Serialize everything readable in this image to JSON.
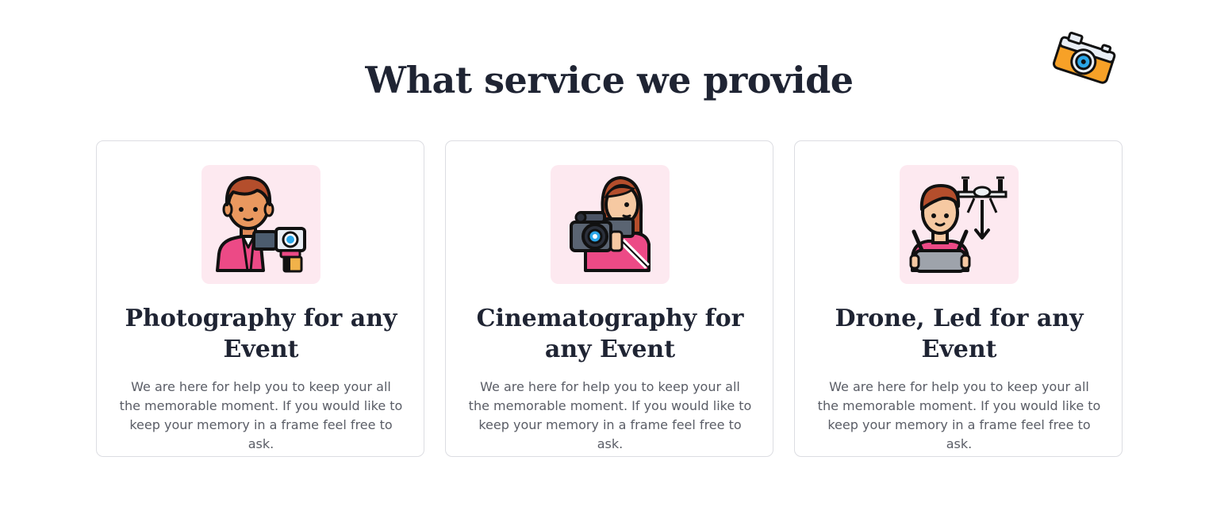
{
  "section": {
    "title": "What service we provide"
  },
  "decor": {
    "camera_icon": "camera-icon"
  },
  "services": [
    {
      "title": "Photography for any Event",
      "description": "We are here for help you to keep your all the memorable moment. If you would like to keep your memory in a frame feel free to ask.",
      "icon": "photographer-icon"
    },
    {
      "title": "Cinematography for any Event",
      "description": "We are here for help you to keep your all the memorable moment. If you would like to keep your memory in a frame feel free to ask.",
      "icon": "videographer-icon"
    },
    {
      "title": "Drone, Led for any Event",
      "description": "We are here for help you to keep your all the memorable moment. If you would like to keep your memory in a frame feel free to ask.",
      "icon": "drone-pilot-icon"
    }
  ],
  "colors": {
    "heading": "#1f2433",
    "body_text": "#5a5d66",
    "icon_background": "#fde9f0",
    "accent_pink": "#ec4a86",
    "camera_orange": "#f7a127",
    "camera_lens_blue": "#2aa6e8"
  }
}
